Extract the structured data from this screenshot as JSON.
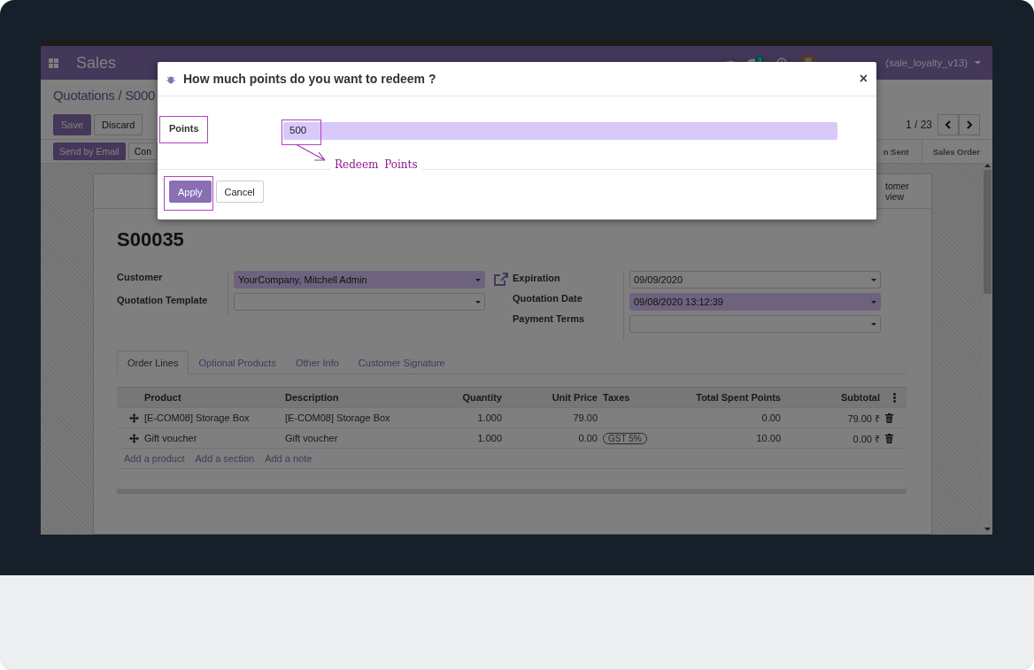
{
  "navbar": {
    "app": "Sales",
    "message_count": "3",
    "user": "(sale_loyalty_v13)"
  },
  "breadcrumb": "Quotations / S000",
  "actions": [
    {
      "label": "Save",
      "kind": "primary"
    },
    {
      "label": "Discard",
      "kind": "secondary"
    }
  ],
  "pager": "1 / 23",
  "header_buttons": [
    {
      "label": "Send by Email",
      "kind": "primary"
    },
    {
      "label": "Con",
      "kind": "secondary"
    }
  ],
  "status_steps": [
    "n Sent",
    "Sales Order"
  ],
  "smart_button": [
    "tomer",
    "view"
  ],
  "record": {
    "name": "S00035",
    "fields_left": [
      {
        "label": "Customer",
        "value": "YourCompany, Mitchell Admin",
        "required": true
      },
      {
        "label": "Quotation Template",
        "required": false
      }
    ],
    "fields_right": [
      {
        "label": "Expiration",
        "value": "09/09/2020",
        "required": false
      },
      {
        "label": "Quotation Date",
        "value": "09/08/2020 13:12:39",
        "required": true
      },
      {
        "label": "Payment Terms",
        "required": false
      }
    ]
  },
  "tabs": [
    {
      "label": "Order Lines",
      "selected": true
    },
    {
      "label": "Optional Products",
      "selected": false
    },
    {
      "label": "Other Info",
      "selected": false
    },
    {
      "label": "Customer Signature",
      "selected": false
    }
  ],
  "table": {
    "columns": [
      "Product",
      "Description",
      "Quantity",
      "Unit Price",
      "Taxes",
      "Total Spent Points",
      "Subtotal"
    ],
    "rows": [
      {
        "product": "[E-COM08] Storage Box",
        "description": "[E-COM08] Storage Box",
        "quantity": "1.000",
        "unit_price": "79.00",
        "total_spent_points": "0.00",
        "subtotal": "79.00 ₹"
      },
      {
        "product": "Gift voucher",
        "description": "Gift voucher",
        "quantity": "1.000",
        "unit_price": "0.00",
        "taxes": [
          "GST 5%"
        ],
        "total_spent_points": "10.00",
        "subtotal": "0.00 ₹"
      }
    ],
    "add_links": [
      "Add a product",
      "Add a section",
      "Add a note"
    ]
  },
  "dialog": {
    "title": "How much points do you want to redeem ?",
    "close": "×",
    "field_label": "Points",
    "value": "500",
    "buttons": [
      {
        "label": "Apply",
        "kind": "primary"
      },
      {
        "label": "Cancel",
        "kind": "secondary"
      }
    ]
  },
  "annotation": {
    "text": "Redeem Points"
  }
}
